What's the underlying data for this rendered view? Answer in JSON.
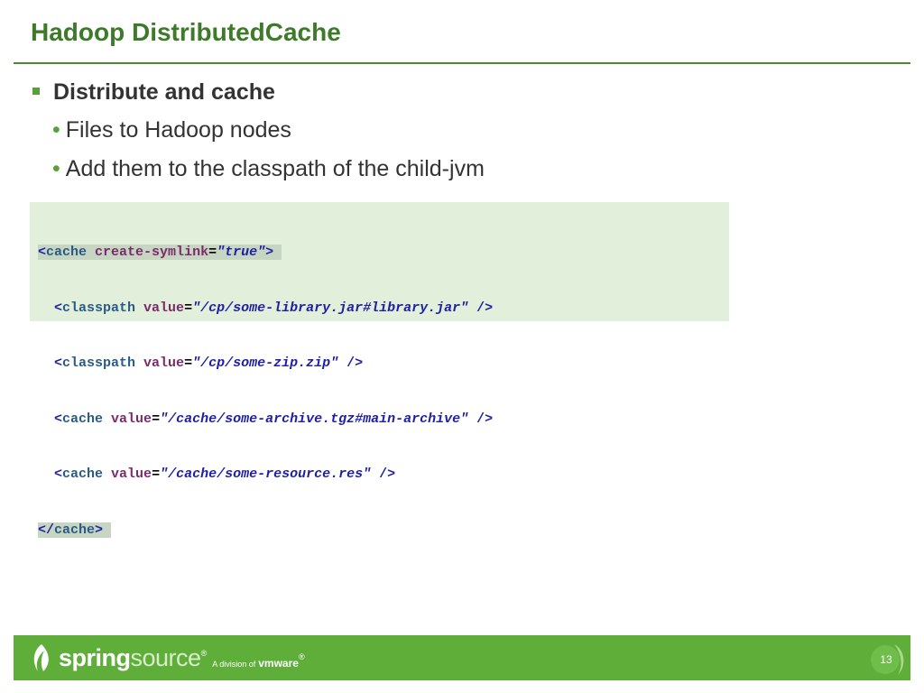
{
  "slide": {
    "title": "Hadoop DistributedCache",
    "bullet_l1": "Distribute and cache",
    "bullets_l2": [
      "Files to Hadoop nodes",
      "Add them to the classpath of the child-jvm"
    ],
    "bullet_char": "•",
    "code": {
      "line1": [
        "<",
        "cache",
        " ",
        "create-symlink",
        "=",
        "\"true\"",
        ">"
      ],
      "line2": [
        "  <",
        "classpath",
        " ",
        "value",
        "=",
        "\"/cp/some-library.jar#library.jar\"",
        " />"
      ],
      "line3": [
        "  <",
        "classpath",
        " ",
        "value",
        "=",
        "\"/cp/some-zip.zip\"",
        " />"
      ],
      "line4": [
        "  <",
        "cache",
        " ",
        "value",
        "=",
        "\"/cache/some-archive.tgz#main-archive\"",
        " />"
      ],
      "line5": [
        "  <",
        "cache",
        " ",
        "value",
        "=",
        "\"/cache/some-resource.res\"",
        " />"
      ],
      "line6": [
        "</",
        "cache",
        ">"
      ]
    },
    "page_number": "13"
  },
  "footer": {
    "brand_spring": "spring",
    "brand_source": "source",
    "registered": "®",
    "division_text": "A division of",
    "vmware": "vmware",
    "vmware_registered": "®"
  },
  "colors": {
    "title": "#3d7a2a",
    "accent": "#58a037",
    "footer_bg": "#5fae3a",
    "code_bg": "#e2efda"
  },
  "icons": {
    "logo": "springsource-leaf-icon",
    "bullet": "square-bullet-icon"
  }
}
